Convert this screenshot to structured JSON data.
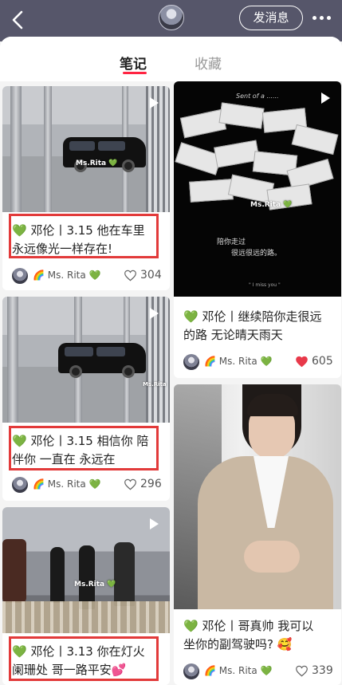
{
  "header": {
    "back_icon": "chevron-left-icon",
    "message_button": "发消息",
    "more_icon": "more-icon"
  },
  "tabs": [
    {
      "label": "笔记",
      "active": true
    },
    {
      "label": "收藏",
      "active": false
    }
  ],
  "colors": {
    "accent": "#ff2442",
    "header_bg": "#56566a",
    "highlight": "#e23a3a",
    "liked_heart": "#e8394a"
  },
  "left_column": [
    {
      "title_line1": "💚 邓伦丨3.15 他在车里",
      "title_line2": "永远像光一样存在!",
      "author": "🌈 Ms. Rita 💚",
      "likes": "304",
      "liked": false,
      "watermark": "Ms.Rita 💚",
      "is_video": true
    },
    {
      "title_line1": "💚 邓伦丨3.15 相信你 陪",
      "title_line2": "伴你 一直在 永远在",
      "author": "🌈 Ms. Rita 💚",
      "likes": "296",
      "liked": false,
      "watermark": "Ms.Rita",
      "is_video": true
    },
    {
      "title_line1": "💚 邓伦丨3.13 你在灯火",
      "title_line2": "阑珊处 哥一路平安💕",
      "author": "",
      "likes": "",
      "watermark": "Ms.Rita 💚",
      "is_video": true
    }
  ],
  "right_column": [
    {
      "title_line1": "💚 邓伦丨继续陪你走很远",
      "title_line2": "的路 无论晴天雨天",
      "author": "🌈 Ms. Rita 💚",
      "likes": "605",
      "liked": true,
      "watermark": "Ms.Rita 💚",
      "is_video": true,
      "image_caption_top": "Sent of a ......",
      "image_caption_l1": "陪你走过",
      "image_caption_l2": "很远很远的路。",
      "image_caption_bottom": "\" I miss you \""
    },
    {
      "title_line1": "💚 邓伦丨哥真帅 我可以",
      "title_line2": "坐你的副驾驶吗? 🥰",
      "author": "🌈 Ms. Rita 💚",
      "likes": "339",
      "liked": false
    }
  ]
}
